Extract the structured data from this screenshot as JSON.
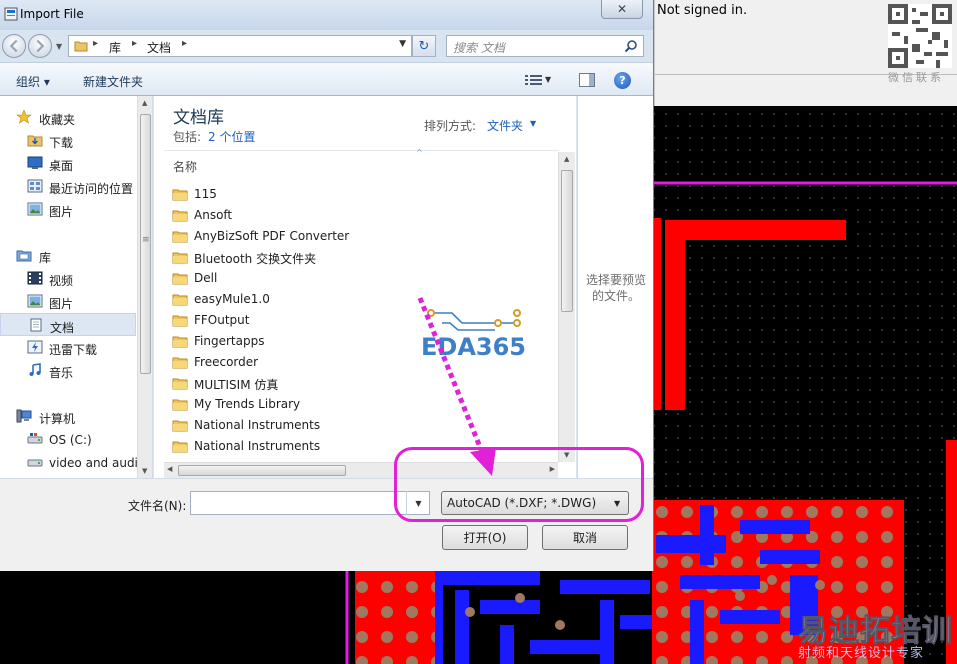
{
  "background": {
    "status_text": "Not signed in.",
    "qr_label": "微信联系",
    "watermark_main": "易迪拓培训",
    "watermark_sub": "射频和天线设计专家"
  },
  "dialog": {
    "title": "Import File",
    "close_glyph": "✕",
    "breadcrumb": [
      "库",
      "文档"
    ],
    "search_placeholder": "搜索 文档",
    "toolbar": {
      "organize": "组织 ▾",
      "new_folder": "新建文件夹",
      "help": "?"
    },
    "nav": {
      "groups": [
        {
          "label": "收藏夹",
          "icon": "star-icon",
          "items": [
            {
              "label": "下载",
              "icon": "download-folder-icon"
            },
            {
              "label": "桌面",
              "icon": "desktop-icon"
            },
            {
              "label": "最近访问的位置",
              "icon": "recent-places-icon"
            },
            {
              "label": "图片",
              "icon": "pictures-icon"
            }
          ]
        },
        {
          "label": "库",
          "icon": "libraries-icon",
          "items": [
            {
              "label": "视频",
              "icon": "videos-icon"
            },
            {
              "label": "图片",
              "icon": "pictures-icon"
            },
            {
              "label": "文档",
              "icon": "documents-icon",
              "selected": true
            },
            {
              "label": "迅雷下载",
              "icon": "thunder-download-icon"
            },
            {
              "label": "音乐",
              "icon": "music-icon"
            }
          ]
        },
        {
          "label": "计算机",
          "icon": "computer-icon",
          "items": [
            {
              "label": "OS (C:)",
              "icon": "drive-icon"
            },
            {
              "label": "video and audi",
              "icon": "drive-icon"
            }
          ]
        }
      ]
    },
    "library": {
      "title": "文档库",
      "includes_label": "包括:",
      "locations_link": "2 个位置",
      "arrange_label": "排列方式:",
      "arrange_value": "文件夹"
    },
    "columns": {
      "name": "名称"
    },
    "files": [
      "115",
      "Ansoft",
      "AnyBizSoft PDF Converter",
      "Bluetooth 交换文件夹",
      "Dell",
      "easyMule1.0",
      "FFOutput",
      "Fingertapps",
      "Freecorder",
      "MULTISIM 仿真",
      "My Trends Library",
      "National Instruments",
      "National Instruments"
    ],
    "preview_text": "选择要预览的文件。",
    "filename_label": "文件名(N):",
    "filename_value": "",
    "filetype_value": "AutoCAD (*.DXF; *.DWG)",
    "open_label": "打开(O)",
    "cancel_label": "取消"
  },
  "overlay": {
    "logo_text": "EDA365"
  },
  "colors": {
    "pcb_red": "#ff0000",
    "pcb_blue": "#1a1aff",
    "pcb_pad": "#a07860",
    "pcb_border": "#e818e8",
    "annotation": "#e021d8",
    "link_blue": "#1f5fbf"
  }
}
